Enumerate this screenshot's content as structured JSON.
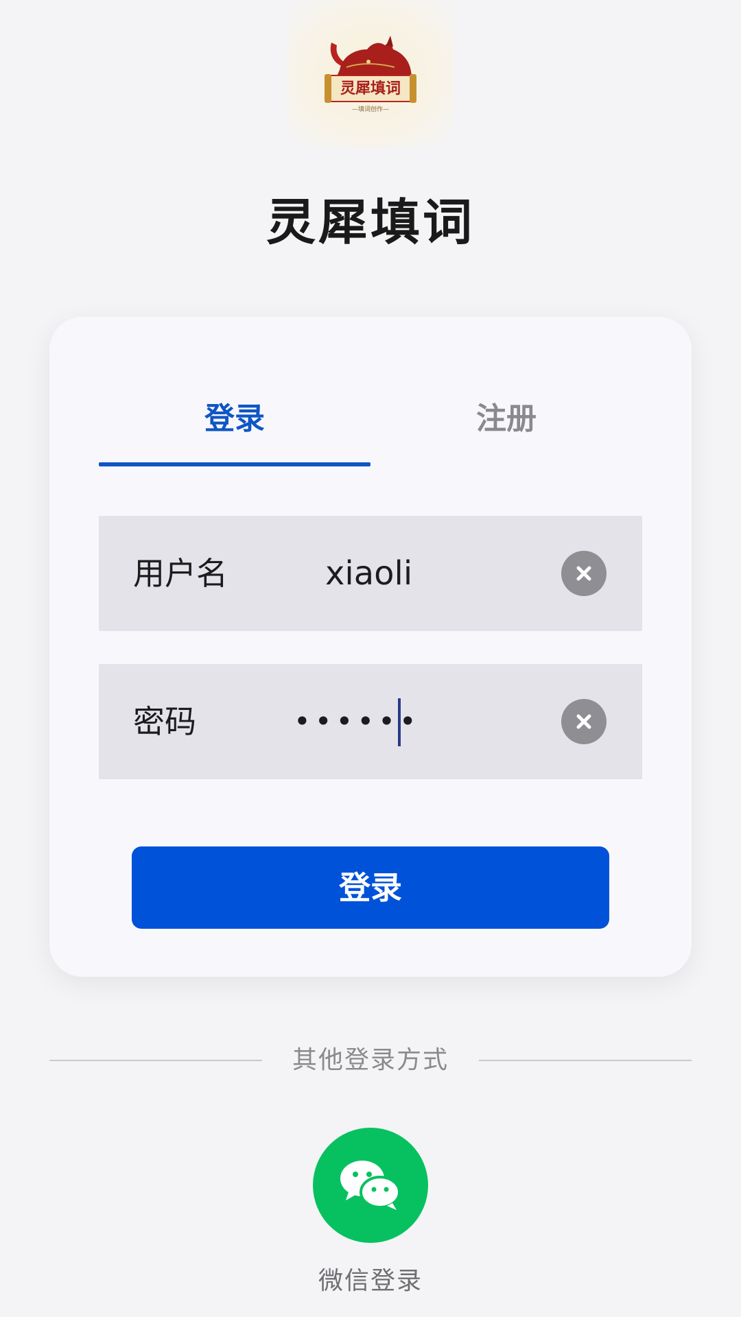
{
  "app": {
    "title": "灵犀填词",
    "logo_text": "灵犀填词",
    "logo_subtext": "—填词创作—"
  },
  "tabs": [
    {
      "label": "登录",
      "active": true
    },
    {
      "label": "注册",
      "active": false
    }
  ],
  "form": {
    "username": {
      "label": "用户名",
      "value": "xiaoli"
    },
    "password": {
      "label": "密码",
      "value": "••••••"
    },
    "submit_label": "登录"
  },
  "other_login": {
    "divider_text": "其他登录方式",
    "wechat_label": "微信登录"
  },
  "colors": {
    "accent": "#0f56c4",
    "button": "#0052d9",
    "wechat": "#07c160"
  },
  "icons": {
    "clear": "close-circle-icon",
    "wechat": "wechat-icon",
    "logo": "rhino-logo"
  }
}
